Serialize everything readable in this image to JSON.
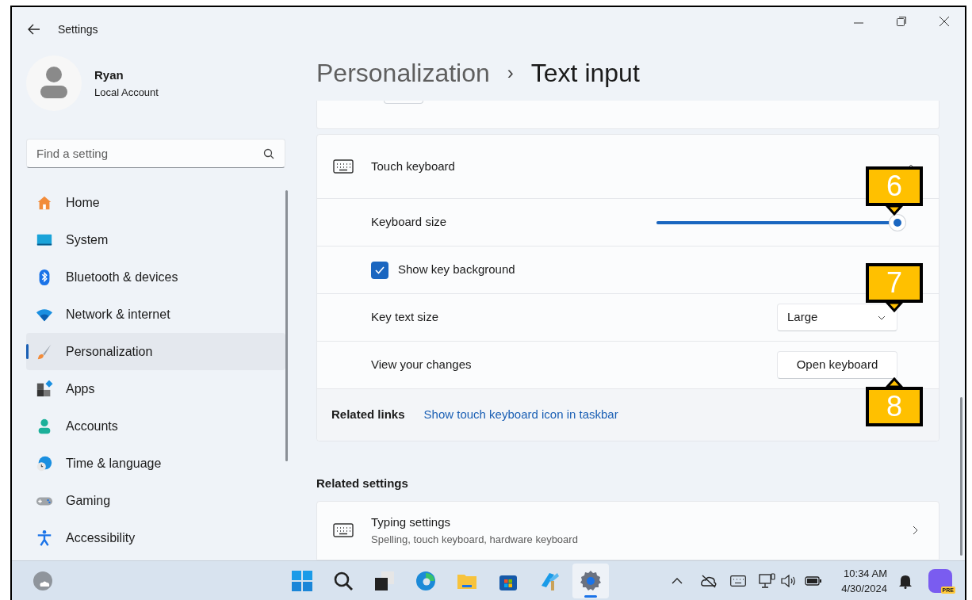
{
  "window": {
    "title": "Settings"
  },
  "account": {
    "name": "Ryan",
    "type": "Local Account"
  },
  "search": {
    "placeholder": "Find a setting"
  },
  "nav": [
    {
      "label": "Home",
      "kind": "home",
      "selected": false
    },
    {
      "label": "System",
      "kind": "system",
      "selected": false
    },
    {
      "label": "Bluetooth & devices",
      "kind": "bluetooth",
      "selected": false
    },
    {
      "label": "Network & internet",
      "kind": "network",
      "selected": false
    },
    {
      "label": "Personalization",
      "kind": "personalization",
      "selected": true
    },
    {
      "label": "Apps",
      "kind": "apps",
      "selected": false
    },
    {
      "label": "Accounts",
      "kind": "accounts",
      "selected": false
    },
    {
      "label": "Time & language",
      "kind": "time",
      "selected": false
    },
    {
      "label": "Gaming",
      "kind": "gaming",
      "selected": false
    },
    {
      "label": "Accessibility",
      "kind": "accessibility",
      "selected": false
    }
  ],
  "breadcrumb": {
    "parent": "Personalization",
    "separator": "›",
    "current": "Text input"
  },
  "touch_keyboard": {
    "title": "Touch keyboard",
    "expanded": true,
    "rows": [
      {
        "kind": "slider",
        "label": "Keyboard size",
        "level": 1
      },
      {
        "kind": "checkbox",
        "label": "Show key background",
        "checked": true
      },
      {
        "kind": "dropdown",
        "label": "Key text size",
        "value": "Large"
      },
      {
        "kind": "button",
        "label": "View your changes",
        "button": "Open keyboard"
      }
    ],
    "related_links": {
      "label": "Related links",
      "link": "Show touch keyboard icon in taskbar"
    }
  },
  "related_settings": {
    "heading": "Related settings",
    "items": [
      {
        "title": "Typing settings",
        "subtitle": "Spelling, touch keyboard, hardware keyboard"
      }
    ]
  },
  "callouts": [
    {
      "label": "6",
      "kind": "down"
    },
    {
      "label": "7",
      "kind": "down"
    },
    {
      "label": "8",
      "kind": "up"
    }
  ],
  "taskbar": {
    "apps": [
      {
        "kind": "start",
        "selected": false
      },
      {
        "kind": "search",
        "selected": false
      },
      {
        "kind": "taskview",
        "selected": false
      },
      {
        "kind": "edge",
        "selected": false
      },
      {
        "kind": "files",
        "selected": false
      },
      {
        "kind": "store",
        "selected": false
      },
      {
        "kind": "tool",
        "selected": false
      },
      {
        "kind": "settings",
        "selected": true
      }
    ],
    "time": "10:34 AM",
    "date": "4/30/2024",
    "copilot_badge": "PRE"
  }
}
